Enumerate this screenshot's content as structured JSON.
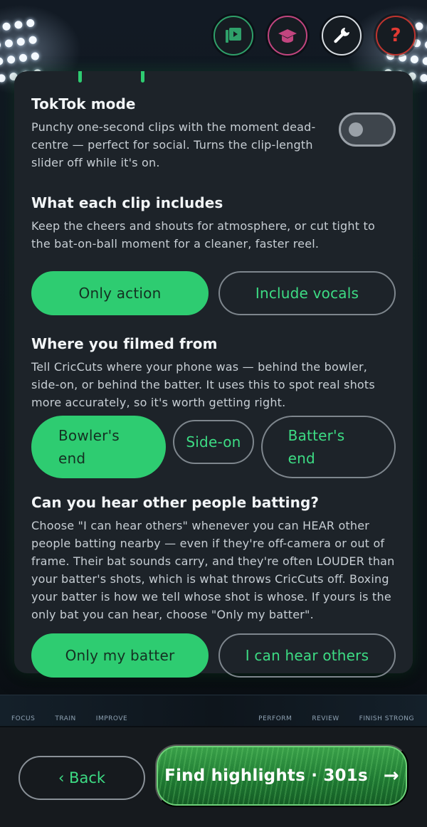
{
  "top_icons": [
    {
      "name": "video-library-icon",
      "color": "#2fa06a"
    },
    {
      "name": "graduation-cap-icon",
      "color": "#c2457f"
    },
    {
      "name": "wrench-icon",
      "color": "#ffffff"
    },
    {
      "name": "help-icon",
      "label": "?",
      "color": "#c0342e"
    }
  ],
  "toktok": {
    "title": "TokTok mode",
    "description": "Punchy one-second clips with the moment dead-centre — perfect for social. Turns the clip-length slider off while it's on.",
    "enabled": false
  },
  "clip_includes": {
    "title": "What each clip includes",
    "description": "Keep the cheers and shouts for atmosphere, or cut tight to the bat-on-ball moment for a cleaner, faster reel.",
    "options": [
      "Only action",
      "Include vocals"
    ],
    "selected": "Only action"
  },
  "filmed_from": {
    "title": "Where you filmed from",
    "description": "Tell CricCuts where your phone was — behind the bowler, side-on, or behind the batter. It uses this to spot real shots more accurately, so it's worth getting right.",
    "options": [
      "Bowler's end",
      "Side-on",
      "Batter's end"
    ],
    "selected": "Bowler's end"
  },
  "hear_others": {
    "title": "Can you hear other people batting?",
    "description": "Choose \"I can hear others\" whenever you can HEAR other people batting nearby — even if they're off-camera or out of frame. Their bat sounds carry, and they're often LOUDER than your batter's shots, which is what throws CricCuts off. Boxing your batter is how we tell whose shot is whose. If yours is the only bat you can hear, choose \"Only my batter\".",
    "options": [
      "Only my batter",
      "I can hear others"
    ],
    "selected": "Only my batter"
  },
  "banner": {
    "left": [
      "FOCUS",
      "TRAIN",
      "IMPROVE"
    ],
    "right": [
      "PERFORM",
      "REVIEW",
      "FINISH STRONG"
    ]
  },
  "footer": {
    "back_label": "‹ Back",
    "find_label": "Find highlights · 301s",
    "find_arrow": "→"
  },
  "colors": {
    "accent": "#2ecc71",
    "card": "#1d2329",
    "background": "#0b1016"
  }
}
